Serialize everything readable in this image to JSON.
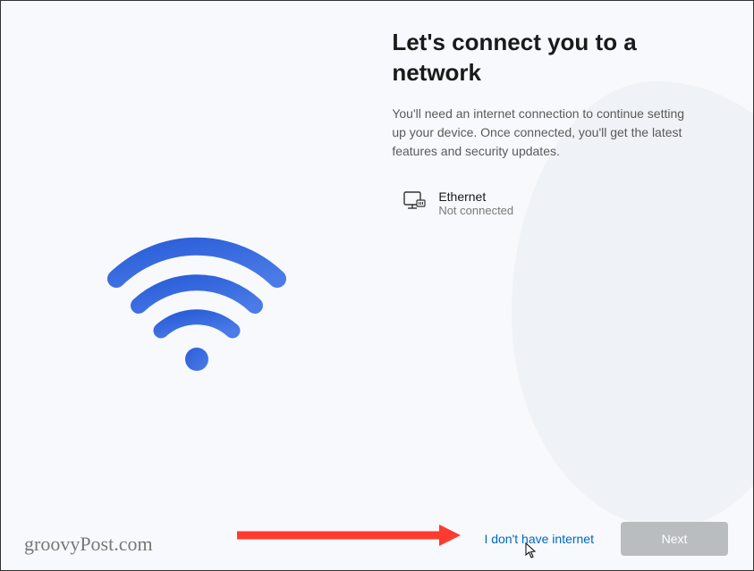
{
  "heading": "Let's connect you to a network",
  "description": "You'll need an internet connection to continue setting up your device. Once connected, you'll get the latest features and security updates.",
  "network": {
    "name": "Ethernet",
    "status": "Not connected"
  },
  "footer": {
    "no_internet_label": "I don't have internet",
    "next_label": "Next"
  },
  "watermark": "groovyPost.com"
}
